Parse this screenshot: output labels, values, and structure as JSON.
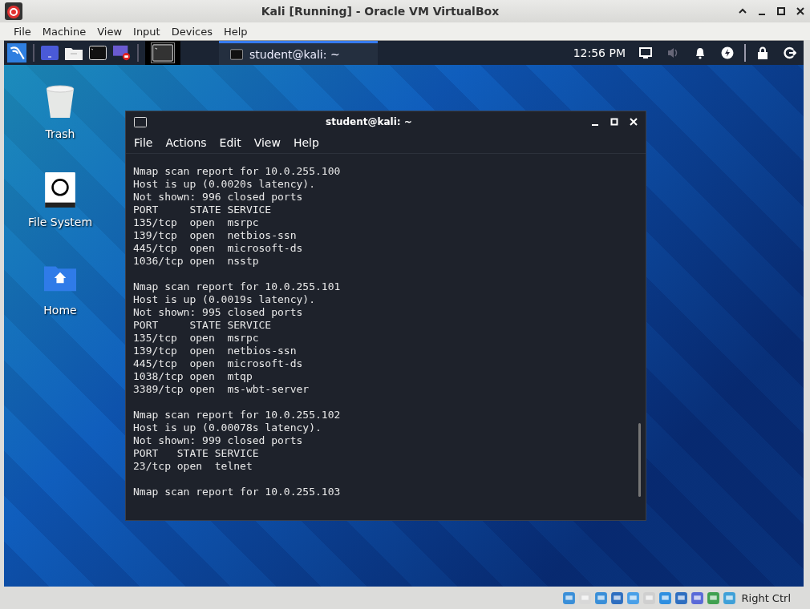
{
  "window": {
    "title": "Kali [Running] - Oracle VM VirtualBox"
  },
  "menu": [
    "File",
    "Machine",
    "View",
    "Input",
    "Devices",
    "Help"
  ],
  "panel": {
    "tasks": [
      {
        "label": "student@kali: ~",
        "selected": true
      }
    ],
    "clock": "12:56 PM"
  },
  "desktop_icons": [
    {
      "kind": "trash",
      "label": "Trash"
    },
    {
      "kind": "drive",
      "label": "File System"
    },
    {
      "kind": "home",
      "label": "Home"
    }
  ],
  "terminal": {
    "title": "student@kali: ~",
    "menu": [
      "File",
      "Actions",
      "Edit",
      "View",
      "Help"
    ],
    "output_blocks": [
      {
        "lines": [
          "Nmap scan report for 10.0.255.100",
          "Host is up (0.0020s latency).",
          "Not shown: 996 closed ports",
          "PORT     STATE SERVICE",
          "135/tcp  open  msrpc",
          "139/tcp  open  netbios-ssn",
          "445/tcp  open  microsoft-ds",
          "1036/tcp open  nsstp"
        ]
      },
      {
        "lines": [
          "Nmap scan report for 10.0.255.101",
          "Host is up (0.0019s latency).",
          "Not shown: 995 closed ports",
          "PORT     STATE SERVICE",
          "135/tcp  open  msrpc",
          "139/tcp  open  netbios-ssn",
          "445/tcp  open  microsoft-ds",
          "1038/tcp open  mtqp",
          "3389/tcp open  ms-wbt-server"
        ]
      },
      {
        "lines": [
          "Nmap scan report for 10.0.255.102",
          "Host is up (0.00078s latency).",
          "Not shown: 999 closed ports",
          "PORT   STATE SERVICE",
          "23/tcp open  telnet"
        ]
      },
      {
        "lines": [
          "Nmap scan report for 10.0.255.103"
        ]
      }
    ]
  },
  "status_bar": {
    "host_key": "Right Ctrl"
  }
}
